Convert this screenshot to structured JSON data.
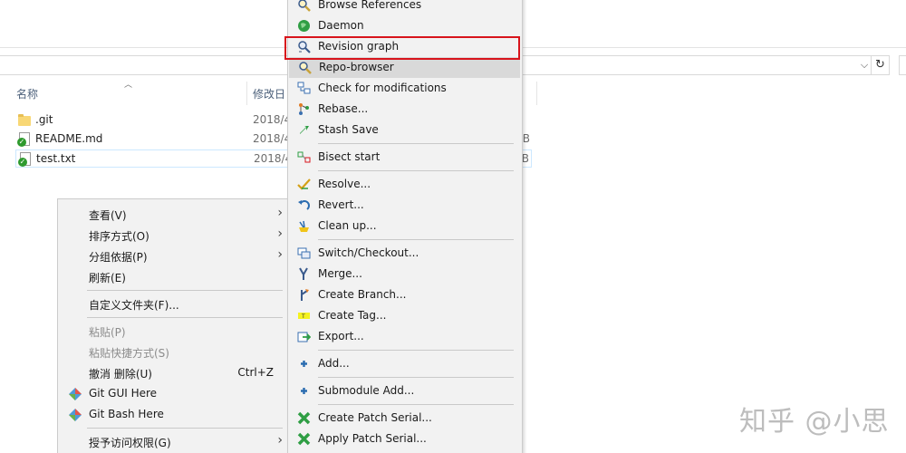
{
  "explorer": {
    "columns": {
      "name": "名称",
      "modified": "修改日"
    },
    "files": [
      {
        "name": ".git",
        "date": "2018/4",
        "size": ""
      },
      {
        "name": "README.md",
        "date": "2018/4",
        "size": "B"
      },
      {
        "name": "test.txt",
        "date": "2018/4",
        "size": "B"
      }
    ]
  },
  "context_menu": {
    "view": "查看(V)",
    "sort_by": "排序方式(O)",
    "group_by": "分组依据(P)",
    "refresh": "刷新(E)",
    "customize_folder": "自定义文件夹(F)...",
    "paste": "粘贴(P)",
    "paste_shortcut": "粘贴快捷方式(S)",
    "undo_delete": "撤消 删除(U)",
    "undo_shortcut": "Ctrl+Z",
    "git_gui_here": "Git GUI Here",
    "git_bash_here": "Git Bash Here",
    "grant_access": "授予访问权限(G)"
  },
  "tortoise_menu": {
    "browse_references": "Browse References",
    "daemon": "Daemon",
    "revision_graph": "Revision graph",
    "repo_browser": "Repo-browser",
    "check_modifications": "Check for modifications",
    "rebase": "Rebase...",
    "stash_save": "Stash Save",
    "bisect_start": "Bisect start",
    "resolve": "Resolve...",
    "revert": "Revert...",
    "clean_up": "Clean up...",
    "switch_checkout": "Switch/Checkout...",
    "merge": "Merge...",
    "create_branch": "Create Branch...",
    "create_tag": "Create Tag...",
    "export": "Export...",
    "add": "Add...",
    "submodule_add": "Submodule Add...",
    "create_patch_serial": "Create Patch Serial...",
    "apply_patch_serial": "Apply Patch Serial..."
  },
  "watermark": "知乎 @小思",
  "colors": {
    "highlight": "#d8141c",
    "hover": "#d9d9d9",
    "menu_bg": "#f2f2f2"
  }
}
